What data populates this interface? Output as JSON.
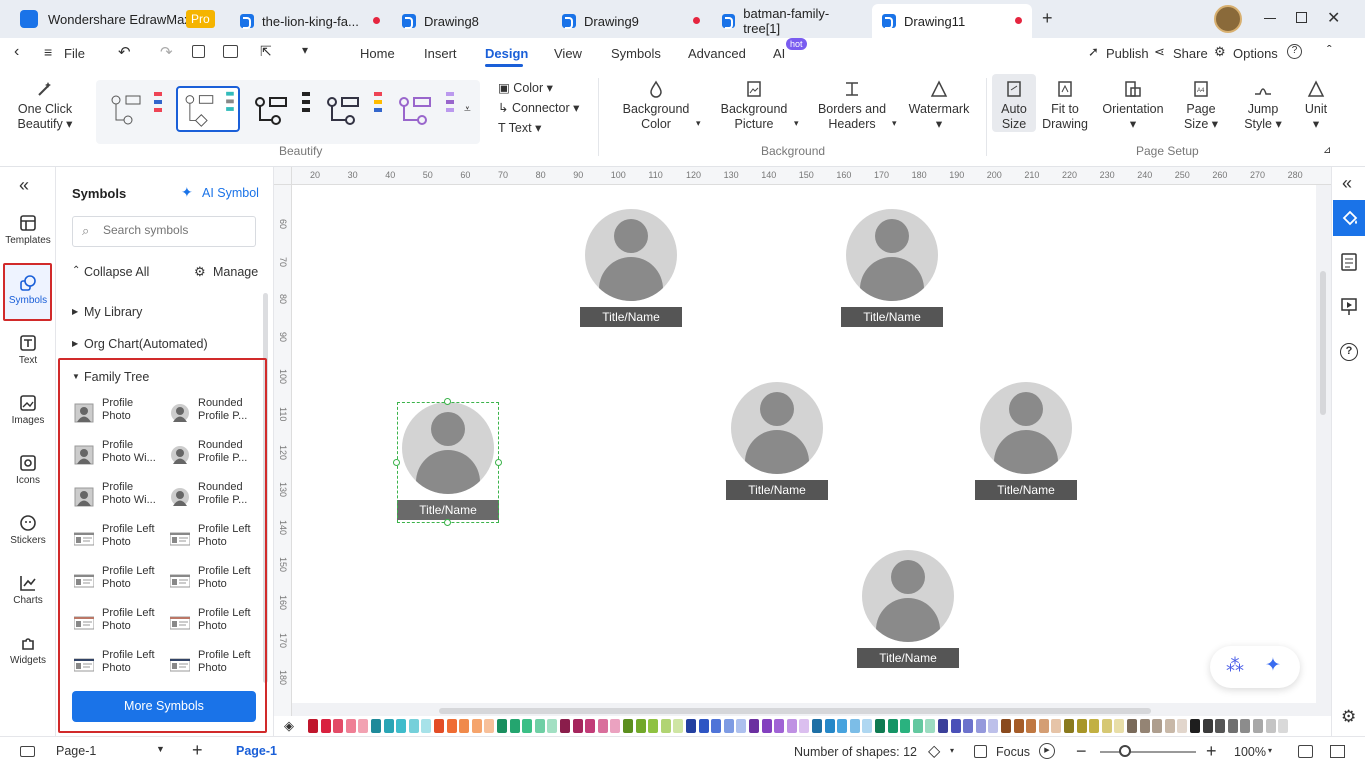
{
  "app": {
    "name": "Wondershare EdrawMax",
    "badge": "Pro"
  },
  "tabs": [
    {
      "label": "the-lion-king-fa...",
      "unsaved": true
    },
    {
      "label": "Drawing8",
      "unsaved": false
    },
    {
      "label": "Drawing9",
      "unsaved": true
    },
    {
      "label": "batman-family-tree[1]",
      "unsaved": false
    },
    {
      "label": "Drawing11",
      "unsaved": true
    }
  ],
  "menu": {
    "file": "File",
    "items": [
      "Home",
      "Insert",
      "Design",
      "View",
      "Symbols",
      "Advanced",
      "AI"
    ],
    "active": "Design",
    "ai_badge": "hot",
    "publish": "Publish",
    "share": "Share",
    "options": "Options"
  },
  "ribbon": {
    "one_click": "One Click",
    "beautify": "Beautify",
    "color": "Color",
    "connector": "Connector",
    "text": "Text",
    "bg_color_1": "Background",
    "bg_color_2": "Color",
    "bg_pic_1": "Background",
    "bg_pic_2": "Picture",
    "borders_1": "Borders and",
    "borders_2": "Headers",
    "watermark": "Watermark",
    "auto_1": "Auto",
    "auto_2": "Size",
    "fit_1": "Fit to",
    "fit_2": "Drawing",
    "orientation": "Orientation",
    "page_1": "Page",
    "page_2": "Size",
    "jump_1": "Jump",
    "jump_2": "Style",
    "unit": "Unit",
    "group_beautify": "Beautify",
    "group_background": "Background",
    "group_pagesetup": "Page Setup"
  },
  "rail": [
    "Templates",
    "Symbols",
    "Text",
    "Images",
    "Icons",
    "Stickers",
    "Charts",
    "Widgets"
  ],
  "panel": {
    "title": "Symbols",
    "ai_symbol": "AI Symbol",
    "search_placeholder": "Search symbols",
    "collapse_all": "Collapse All",
    "manage": "Manage",
    "my_library": "My Library",
    "org_chart": "Org Chart(Automated)",
    "family_tree": "Family Tree",
    "symbols": [
      [
        "Profile",
        "Photo"
      ],
      [
        "Rounded",
        "Profile P..."
      ],
      [
        "Profile",
        "Photo Wi..."
      ],
      [
        "Rounded",
        "Profile P..."
      ],
      [
        "Profile",
        "Photo Wi..."
      ],
      [
        "Rounded",
        "Profile P..."
      ],
      [
        "Profile Left",
        "Photo"
      ],
      [
        "Profile Left",
        "Photo"
      ],
      [
        "Profile Left",
        "Photo"
      ],
      [
        "Profile Left",
        "Photo"
      ],
      [
        "Profile Left",
        "Photo"
      ],
      [
        "Profile Left",
        "Photo"
      ],
      [
        "Profile Left",
        "Photo"
      ],
      [
        "Profile Left",
        "Photo"
      ]
    ],
    "more_symbols": "More Symbols"
  },
  "ruler": {
    "h": [
      "20",
      "30",
      "40",
      "50",
      "60",
      "70",
      "80",
      "90",
      "100",
      "110",
      "120",
      "130",
      "140",
      "150",
      "160",
      "170",
      "180",
      "190",
      "200",
      "210",
      "220",
      "230",
      "240",
      "250",
      "260",
      "270",
      "280"
    ],
    "v": [
      "60",
      "70",
      "80",
      "90",
      "100",
      "110",
      "120",
      "130",
      "140",
      "150",
      "160",
      "170",
      "180"
    ]
  },
  "nodes": [
    {
      "label": "Title/Name"
    },
    {
      "label": "Title/Name"
    },
    {
      "label": "Title/Name"
    },
    {
      "label": "Title/Name"
    },
    {
      "label": "Title/Name"
    },
    {
      "label": "Title/Name"
    }
  ],
  "colors": [
    "#c0162c",
    "#d9213f",
    "#e34b67",
    "#ef7f95",
    "#f2a2b2",
    "#1f8a9a",
    "#2aa5b5",
    "#3fbccb",
    "#75d0da",
    "#a7e2e9",
    "#e34d26",
    "#ef6c33",
    "#f08a4b",
    "#f5a46c",
    "#f7c09a",
    "#1a8f5f",
    "#24a56f",
    "#3bbf86",
    "#6fcfa5",
    "#a2e0c3",
    "#8a1d4b",
    "#a5255d",
    "#c23c78",
    "#d96f9c",
    "#eba2c0",
    "#5b8f1e",
    "#72a82a",
    "#8fc241",
    "#b1d473",
    "#cfe5a4",
    "#2340a0",
    "#2e55c4",
    "#4f74d8",
    "#7e9be3",
    "#adc0ee",
    "#6b2fa0",
    "#8340bf",
    "#a063d5",
    "#bf91e3",
    "#dbbfef",
    "#1d6fa5",
    "#2587c8",
    "#47a3de",
    "#7cbde7",
    "#afd7f1",
    "#0f7a52",
    "#159466",
    "#2ab27f",
    "#63c8a0",
    "#9cdcc1",
    "#3a3f9a",
    "#4a50b8",
    "#6c72cc",
    "#9599dc",
    "#bdc0ea",
    "#8a4a1e",
    "#a55c28",
    "#c07842",
    "#d49e74",
    "#e6c4a8",
    "#8a7a1e",
    "#a89628",
    "#c2b042",
    "#d6c874",
    "#e8dea8",
    "#7a6a5a",
    "#948474",
    "#ae9e8e",
    "#c8b8a8",
    "#e2d6cc",
    "#1e1e1e",
    "#3a3a3a",
    "#555555",
    "#707070",
    "#8c8c8c",
    "#a8a8a8",
    "#c4c4c4",
    "#d9d9d9"
  ],
  "status": {
    "page_select": "Page-1",
    "page_tab": "Page-1",
    "shapes": "Number of shapes: 12",
    "focus": "Focus",
    "zoom": "100%"
  }
}
